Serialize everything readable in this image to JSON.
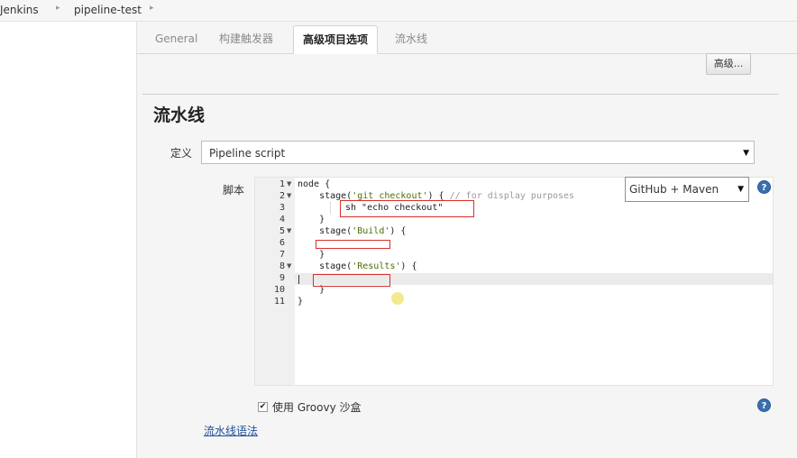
{
  "breadcrumb": {
    "items": [
      "Jenkins",
      "pipeline-test"
    ],
    "separator": "▸"
  },
  "tabs": [
    {
      "label": "General",
      "active": false
    },
    {
      "label": "构建触发器",
      "active": false
    },
    {
      "label": "高级项目选项",
      "active": true
    },
    {
      "label": "流水线",
      "active": false
    }
  ],
  "advanced_button": "高级...",
  "section_title": "流水线",
  "definition": {
    "label": "定义",
    "value": "Pipeline script"
  },
  "script": {
    "label": "脚本",
    "sample_select": "GitHub + Maven",
    "line_numbers": [
      "1",
      "2",
      "3",
      "4",
      "5",
      "6",
      "7",
      "8",
      "9",
      "10",
      "11"
    ],
    "lines": {
      "l1": "node {",
      "l2_a": "    stage(",
      "l2_str": "'git checkout'",
      "l2_b": ") { ",
      "l2_cmt": "// for display purposes",
      "l3": "sh \"echo checkout\"",
      "l4": "    }",
      "l5_a": "    stage(",
      "l5_str": "'Build'",
      "l5_b": ") {",
      "l7": "    }",
      "l8_a": "    stage(",
      "l8_str": "'Results'",
      "l8_b": ") {",
      "l10": "    }",
      "l11": "}"
    }
  },
  "sandbox": {
    "label": "使用 Groovy 沙盒",
    "checked": true
  },
  "syntax_link": "流水线语法",
  "icons": {
    "help": "help-icon",
    "dropdown": "chevron-down-icon",
    "fold": "fold-arrow-icon"
  },
  "colors": {
    "accent_link": "#1f4e99",
    "highlight_box": "#d9302b",
    "help_icon": "#3a6fb0"
  }
}
